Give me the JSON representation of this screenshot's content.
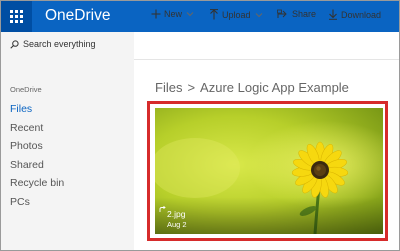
{
  "app": {
    "title": "OneDrive"
  },
  "sidebar": {
    "search_placeholder": "Search everything",
    "section": "OneDrive",
    "items": [
      {
        "label": "Files",
        "active": true
      },
      {
        "label": "Recent"
      },
      {
        "label": "Photos"
      },
      {
        "label": "Shared"
      },
      {
        "label": "Recycle bin"
      },
      {
        "label": "PCs"
      }
    ]
  },
  "commands": {
    "new": "New",
    "upload": "Upload",
    "share": "Share",
    "download": "Download"
  },
  "breadcrumb": {
    "root": "Files",
    "separator": ">",
    "folder": "Azure Logic App Example"
  },
  "file": {
    "name": "2.jpg",
    "date": "Aug 2"
  },
  "colors": {
    "suitebar": "#0a64c2",
    "waffle": "#004ea3",
    "active_nav": "#0a64c2",
    "highlight": "#d62b2b"
  }
}
